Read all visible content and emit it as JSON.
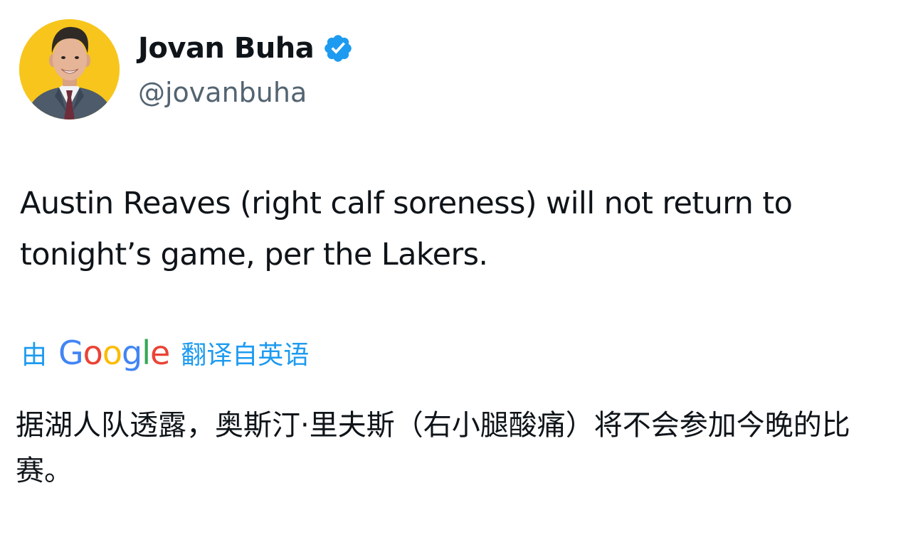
{
  "author": {
    "display_name": "Jovan Buha",
    "handle": "@jovanbuha",
    "verified": true,
    "avatar_bg": "#f7c51c",
    "verified_color": "#1d9bf0"
  },
  "tweet": {
    "text": "Austin Reaves (right calf soreness) will not return to tonight’s game, per the Lakers."
  },
  "translation": {
    "prefix": "由",
    "provider_letters": [
      {
        "char": "G",
        "color": "#4285f4"
      },
      {
        "char": "o",
        "color": "#ea4335"
      },
      {
        "char": "o",
        "color": "#fbbc05"
      },
      {
        "char": "g",
        "color": "#4285f4"
      },
      {
        "char": "l",
        "color": "#34a853"
      },
      {
        "char": "e",
        "color": "#ea4335"
      }
    ],
    "suffix": "翻译自英语",
    "text": "据湖人队透露，奥斯汀·里夫斯（右小腿酸痛）将不会参加今晚的比赛。",
    "link_color": "#1d9bf0"
  },
  "icons": {
    "verified": "verified-badge-icon",
    "avatar": "avatar-photo"
  }
}
